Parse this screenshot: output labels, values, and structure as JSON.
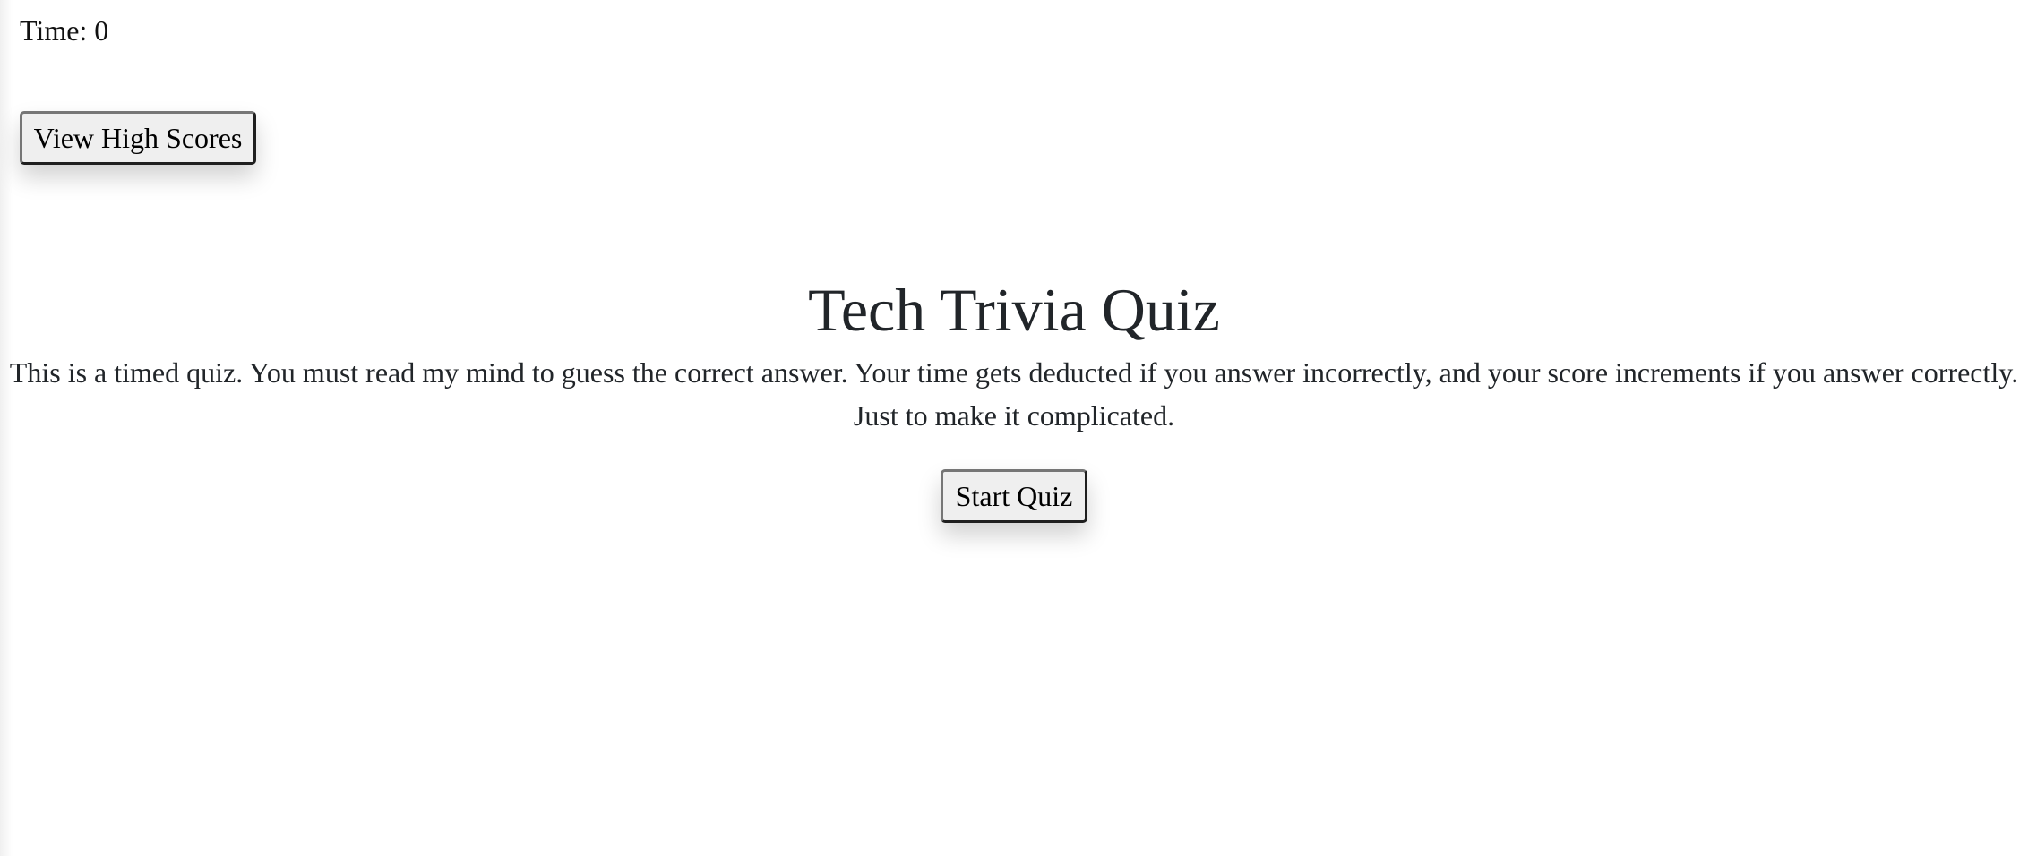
{
  "header": {
    "timer_label": "Time: 0",
    "high_scores_label": "View High Scores"
  },
  "intro": {
    "title": "Tech Trivia Quiz",
    "description_line1": "This is a timed quiz. You must read my mind to guess the correct answer. Your time gets deducted if you answer incorrectly, and your score increments if you answer correctly.",
    "description_line2": "Just to make it complicated.",
    "start_label": "Start Quiz"
  }
}
